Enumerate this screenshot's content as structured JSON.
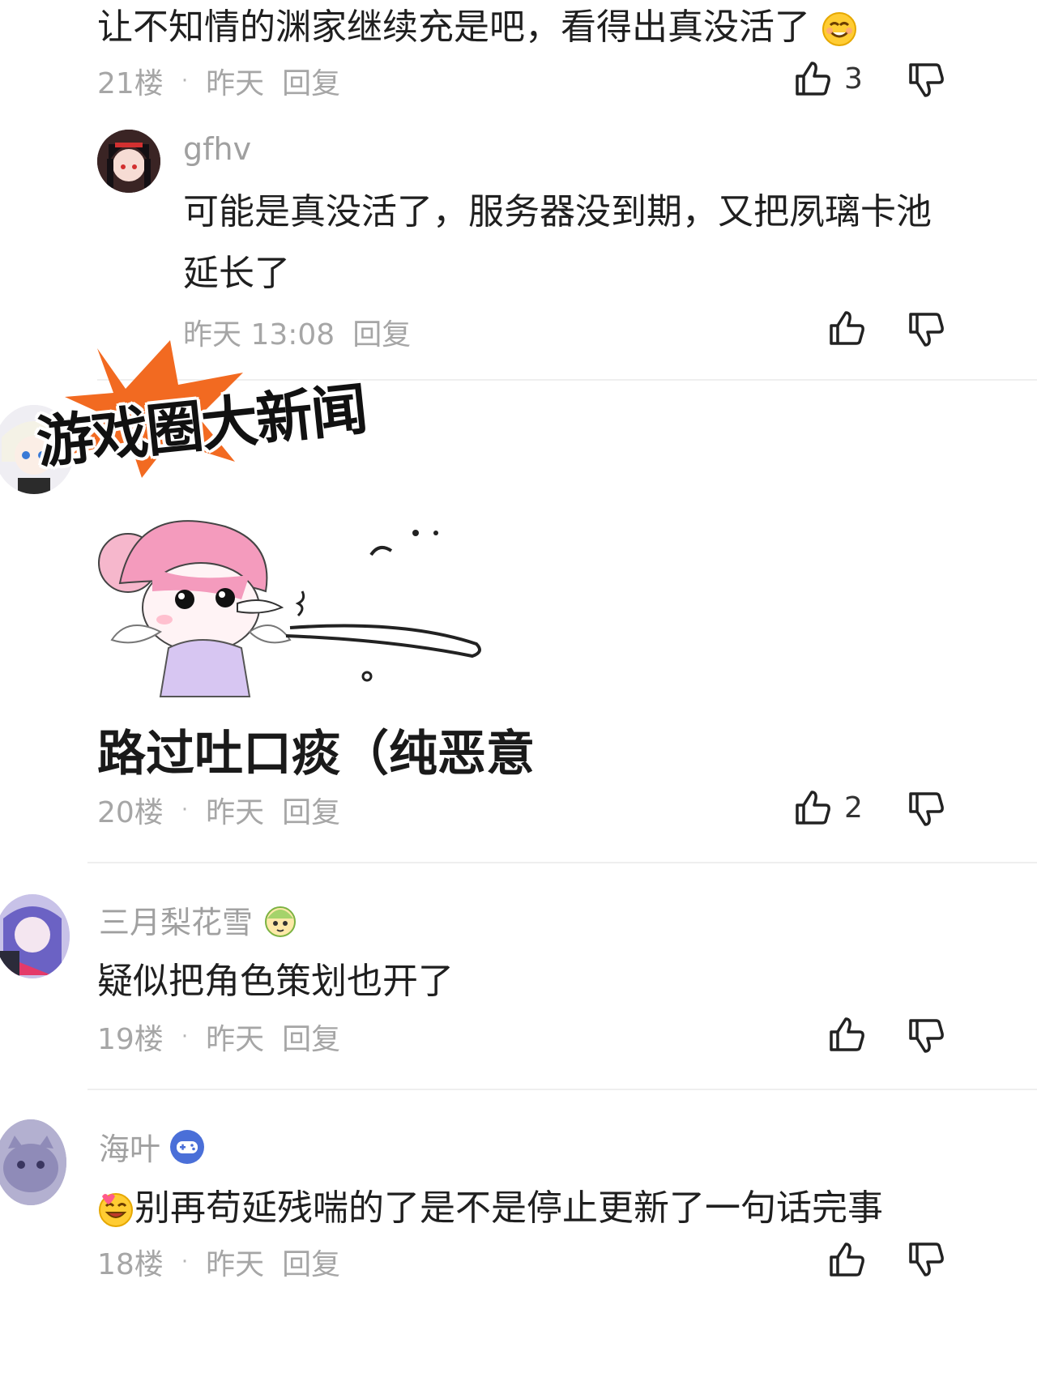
{
  "comments": [
    {
      "text": "让不知情的渊家继续充是吧，看得出真没活了",
      "floor": "21楼",
      "sep": "·",
      "time": "昨天",
      "reply": "回复",
      "likes": "3",
      "replies": [
        {
          "user": "gfhv",
          "text_line1": "可能是真没活了，服务器没到期，又把夙璃卡池",
          "text_line2": "延长了",
          "time": "昨天 13:08",
          "reply": "回复"
        }
      ]
    },
    {
      "banner": "游戏圈大新闻",
      "text": "路过吐口痰（纯恶意",
      "floor": "20楼",
      "sep": "·",
      "time": "昨天",
      "reply": "回复",
      "likes": "2"
    },
    {
      "user": "三月梨花雪",
      "text": "疑似把角色策划也开了",
      "floor": "19楼",
      "sep": "·",
      "time": "昨天",
      "reply": "回复"
    },
    {
      "user": "海叶",
      "text": "别再苟延残喘的了是不是停止更新了一句话完事",
      "floor": "18楼",
      "sep": "·",
      "time": "昨天",
      "reply": "回复"
    }
  ],
  "icons": {
    "like": "thumbs-up-icon",
    "dislike": "thumbs-down-icon",
    "badge_game": "gamepad-badge-icon",
    "smile_emoji": "smile-emoji",
    "grin_emoji": "grin-emoji"
  },
  "colors": {
    "banner_burst": "#f26a21",
    "meta": "#a6a6a6",
    "badge": "#4a6fd8"
  }
}
